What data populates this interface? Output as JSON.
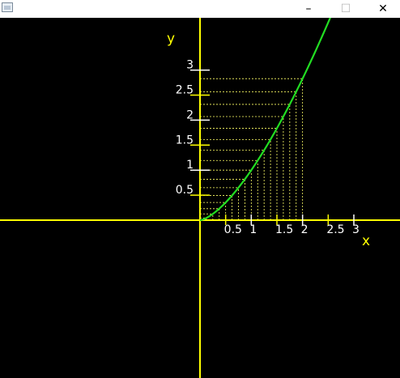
{
  "window": {
    "icon": "app-window-icon",
    "minimize_label": "–",
    "maximize_label": "☐",
    "close_label": "✕"
  },
  "colors": {
    "background": "#000000",
    "axis": "#ffff00",
    "curve": "#22dd22",
    "grid": "#ffff66",
    "tick_mark": "#ffffff",
    "tick_text": "#ffffff",
    "axis_label": "#ffff00"
  },
  "chart_data": {
    "type": "line",
    "xlabel": "x",
    "ylabel": "y",
    "function_points": {
      "x": [
        0,
        0.25,
        0.5,
        0.75,
        1,
        1.25,
        1.5,
        1.75,
        2
      ],
      "y": [
        0,
        0.125,
        0.354,
        0.65,
        1,
        1.4,
        1.84,
        2.32,
        2.83
      ]
    },
    "x_ticks": [
      {
        "value": 0.5,
        "label": "0.5"
      },
      {
        "value": 1,
        "label": "1"
      },
      {
        "value": 1.5,
        "label": "1.5"
      },
      {
        "value": 2,
        "label": "2"
      },
      {
        "value": 2.5,
        "label": "2.5"
      },
      {
        "value": 3,
        "label": "3"
      }
    ],
    "y_ticks": [
      {
        "value": 0.5,
        "label": "0.5"
      },
      {
        "value": 1,
        "label": "1"
      },
      {
        "value": 1.5,
        "label": "1.5"
      },
      {
        "value": 2,
        "label": "2"
      },
      {
        "value": 2.5,
        "label": "2.5"
      },
      {
        "value": 3,
        "label": "3"
      }
    ],
    "grid_x": [
      0.125,
      0.25,
      0.375,
      0.5,
      0.625,
      0.75,
      0.875,
      1,
      1.125,
      1.25,
      1.375,
      1.5,
      1.625,
      1.75,
      1.875,
      2
    ],
    "grid_on": true,
    "xlim": [
      -3.9,
      3.9
    ],
    "ylim": [
      -3.1,
      4.1
    ]
  }
}
